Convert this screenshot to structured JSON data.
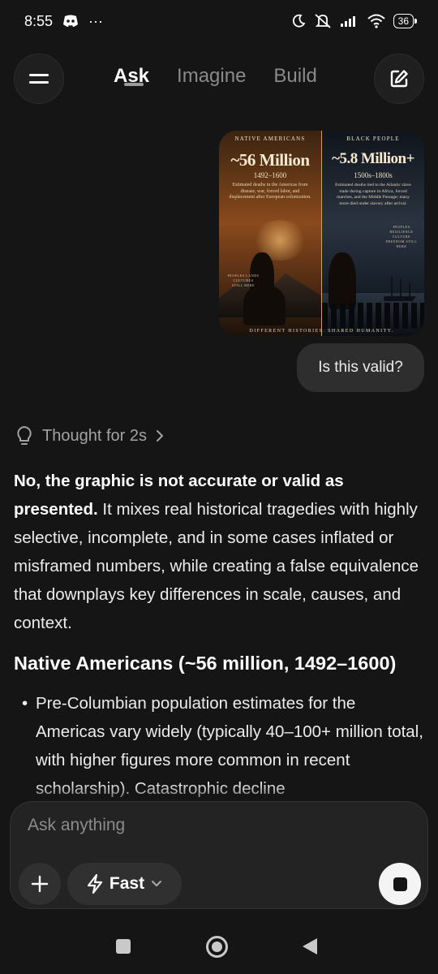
{
  "status_bar": {
    "time": "8:55",
    "more": "···",
    "battery": "36",
    "icons": [
      "discord-icon",
      "moon-icon",
      "mute-icon",
      "signal-icon",
      "wifi-icon",
      "battery-icon"
    ]
  },
  "header": {
    "tabs": [
      {
        "label": "Ask",
        "active": true
      },
      {
        "label": "Imagine",
        "active": false
      },
      {
        "label": "Build",
        "active": false
      }
    ]
  },
  "attached_image": {
    "left": {
      "kicker": "NATIVE AMERICANS",
      "headline": "~56 Million",
      "years": "1492–1600",
      "description": "Estimated deaths in the Americas from disease, war, forced labor, and displacement after European colonization.",
      "side_text": "PEOPLES LANDS CULTURES STILL HERE"
    },
    "right": {
      "kicker": "BLACK PEOPLE",
      "headline": "~5.8 Million+",
      "years": "1500s–1800s",
      "description": "Estimated deaths tied to the Atlantic slave trade during capture in Africa, forced marches, and the Middle Passage; many more died under slavery after arrival.",
      "side_text": "PEOPLES RESILIENCE CULTURE FREEDOM STILL HERE"
    },
    "footer": "DIFFERENT HISTORIES. SHARED HUMANITY."
  },
  "user_message": "Is this valid?",
  "thought": {
    "label": "Thought for 2s"
  },
  "answer": {
    "intro_bold": "No, the graphic is not accurate or valid as presented.",
    "intro_rest": " It mixes real historical tragedies with highly selective, incomplete, and in some cases inflated or misframed numbers, while creating a false equivalence that downplays key differences in scale, causes, and context.",
    "section_heading": "Native Americans (~56 million, 1492–1600)",
    "bullet_1": "Pre-Columbian population estimates for the Americas vary widely (typically 40–100+ million total, with higher figures more common in recent scholarship). Catastrophic decline"
  },
  "composer": {
    "placeholder": "Ask anything",
    "mode_label": "Fast"
  }
}
